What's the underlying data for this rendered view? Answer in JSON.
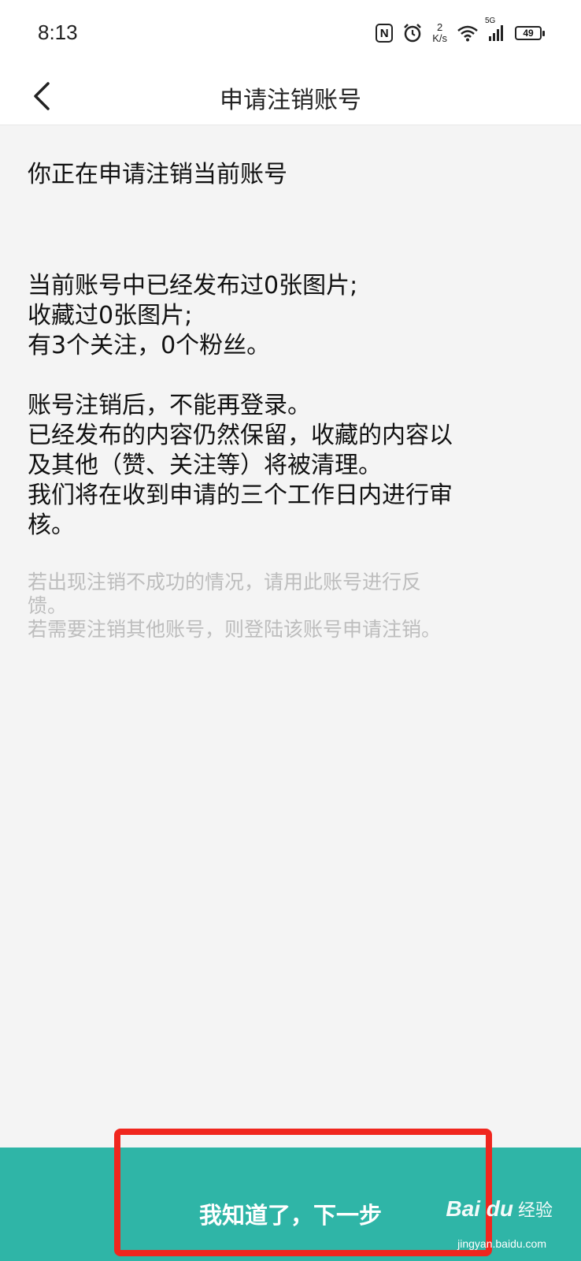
{
  "status_bar": {
    "time": "8:13",
    "speed_value": "2",
    "speed_unit": "K/s",
    "network": "5G",
    "battery": "49"
  },
  "nav": {
    "title": "申请注销账号"
  },
  "content": {
    "heading": "你正在申请注销当前账号",
    "info_lines": [
      "当前账号中已经发布过0张图片;",
      "收藏过0张图片;",
      "有3个关注，0个粉丝。"
    ],
    "rule_lines": [
      "账号注销后，不能再登录。",
      "已经发布的内容仍然保留，收藏的内容以",
      "及其他（赞、关注等）将被清理。",
      "我们将在收到申请的三个工作日内进行审",
      "核。"
    ],
    "note_lines": [
      "若出现注销不成功的情况，请用此账号进行反",
      "馈。",
      "若需要注销其他账号，则登陆该账号申请注销。"
    ]
  },
  "bottom": {
    "button_label": "我知道了，下一步"
  },
  "watermark": {
    "logo": "Bai du",
    "cn": "经验",
    "url": "jingyan.baidu.com"
  },
  "colors": {
    "accent": "#2fb5a7",
    "highlight": "#f0261e",
    "note_text": "#bdbdbd"
  }
}
